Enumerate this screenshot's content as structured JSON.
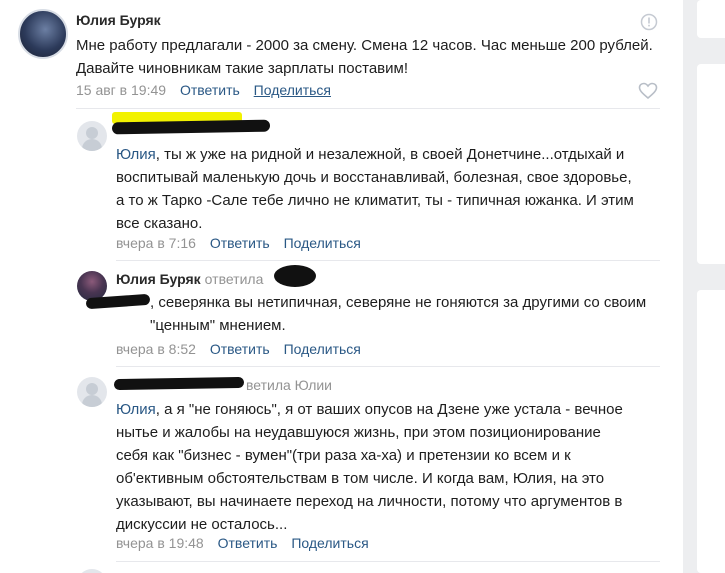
{
  "post": {
    "author": "Юлия Буряк",
    "text": "Мне работу предлагали - 2000 за смену. Смена 12 часов. Час меньше 200 рублей. Давайте чиновникам такие зарплаты поставим!",
    "time": "15 авг в 19:49",
    "reply_label": "Ответить",
    "share_label": "Поделиться"
  },
  "comments": [
    {
      "mention": "Юлия",
      "text": ", ты ж уже на ридной и незалежной, в своей Донетчине...отдыхай и воспитывай маленькую дочь и восстанавливай, болезная, свое здоровье, а то ж Тарко -Сале тебе лично не климатит, ты - типичная южанка. И этим все сказано.",
      "time": "вчера в 7:16",
      "reply_label": "Ответить",
      "share_label": "Поделиться"
    },
    {
      "author": "Юлия Буряк",
      "reply_to": "ответила",
      "text": ", северянка вы нетипичная, северяне не гоняются за другими со своим \"ценным\" мнением.",
      "time": "вчера в 8:52",
      "reply_label": "Ответить",
      "share_label": "Поделиться"
    },
    {
      "reply_to": "ветила Юлии",
      "mention": "Юлия",
      "text": ", а я \"не гоняюсь\", я от ваших опусов на Дзене уже устала - вечное нытье и жалобы на неудавшуюся жизнь, при этом позиционирование себя как \"бизнес - вумен\"(три раза ха-ха) и претензии ко всем и к об'ективным обстоятельствам в том числе. И когда вам, Юлия, на это указывают, вы начинаете переход на личности, потому что аргументов в дискуссии не осталось...",
      "time": "вчера в 19:48",
      "reply_label": "Ответить",
      "share_label": "Поделиться"
    }
  ],
  "icons": {
    "report": "report-icon",
    "like": "heart-icon"
  }
}
